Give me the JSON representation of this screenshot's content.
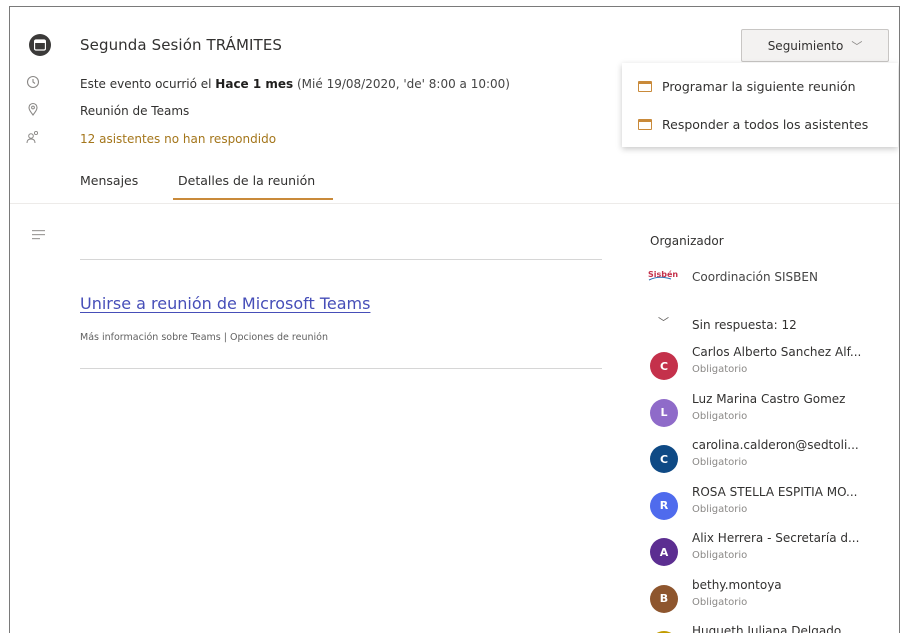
{
  "header": {
    "title": "Segunda Sesión TRÁMITES",
    "when_prefix": "Este evento ocurrió el ",
    "when_bold": "Hace 1 mes",
    "when_rest": " (Mié 19/08/2020, 'de' 8:00 a 10:00)",
    "location": "Reunión de Teams",
    "attendees_status": "12 asistentes no han respondido"
  },
  "tabs": [
    {
      "label": "Mensajes"
    },
    {
      "label": "Detalles de la reunión"
    }
  ],
  "follow_up": {
    "label": "Seguimiento",
    "menu": [
      {
        "label": "Programar la siguiente reunión"
      },
      {
        "label": "Responder a todos los asistentes"
      }
    ]
  },
  "body": {
    "join_link": "Unirse a reunión de Microsoft Teams",
    "more_info": "Más información sobre Teams",
    "separator": " | ",
    "options": "Opciones de reunión"
  },
  "sidebar": {
    "organizer_heading": "Organizador",
    "organizer_logo_text": "Sisbén",
    "organizer_name": "Coordinación SISBEN",
    "no_response": "Sin respuesta: 12",
    "attendees": [
      {
        "initial": "C",
        "name": "Carlos Alberto Sanchez Alf...",
        "role": "Obligatorio",
        "color": "#c4314b"
      },
      {
        "initial": "L",
        "name": "Luz Marina Castro Gomez",
        "role": "Obligatorio",
        "color": "#8f6bc9"
      },
      {
        "initial": "C",
        "name": "carolina.calderon@sedtoli...",
        "role": "Obligatorio",
        "color": "#0f4a85"
      },
      {
        "initial": "R",
        "name": "ROSA STELLA ESPITIA MO...",
        "role": "Obligatorio",
        "color": "#4f6bed"
      },
      {
        "initial": "A",
        "name": "Alix Herrera - Secretaría d...",
        "role": "Obligatorio",
        "color": "#5c2e91"
      },
      {
        "initial": "B",
        "name": "bethy.montoya",
        "role": "Obligatorio",
        "color": "#8e562e"
      },
      {
        "initial": "",
        "name": "Huqueth Juliana Delgado ...",
        "role": "",
        "color": "#c19c00"
      }
    ]
  }
}
